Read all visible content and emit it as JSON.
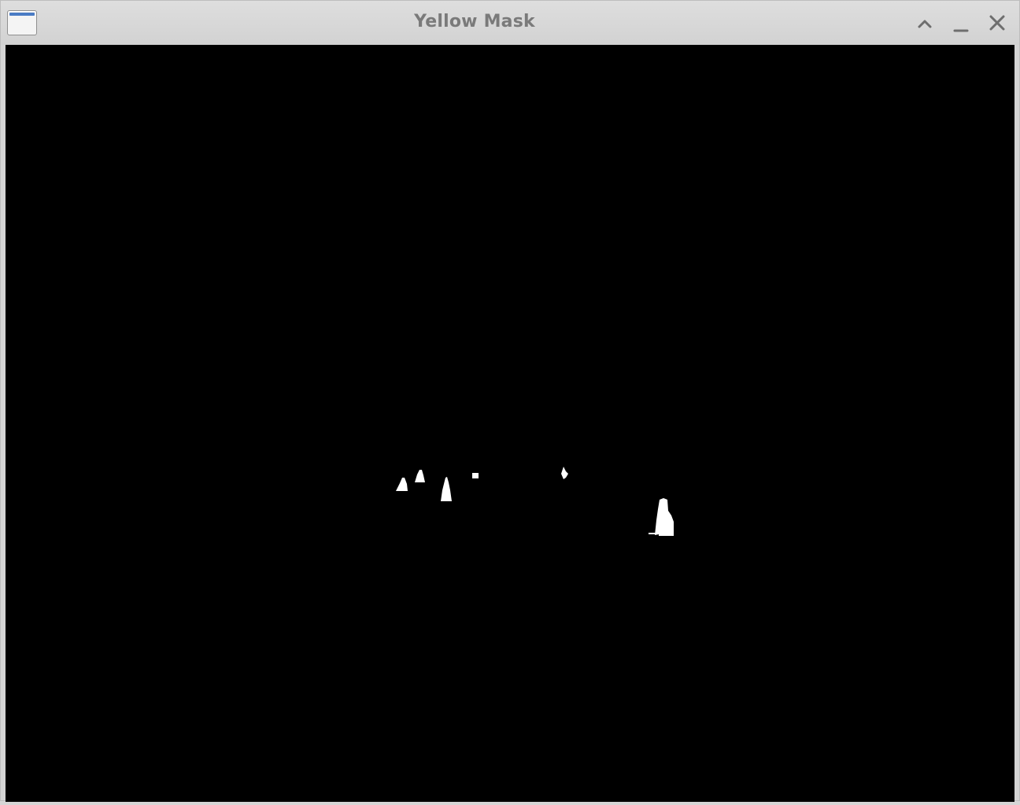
{
  "window": {
    "title": "Yellow Mask",
    "controls": {
      "shade": "chevron-up-icon",
      "minimize": "minimize-icon",
      "close": "close-icon"
    }
  },
  "mask": {
    "background_color": "#000000",
    "foreground_color": "#ffffff"
  }
}
